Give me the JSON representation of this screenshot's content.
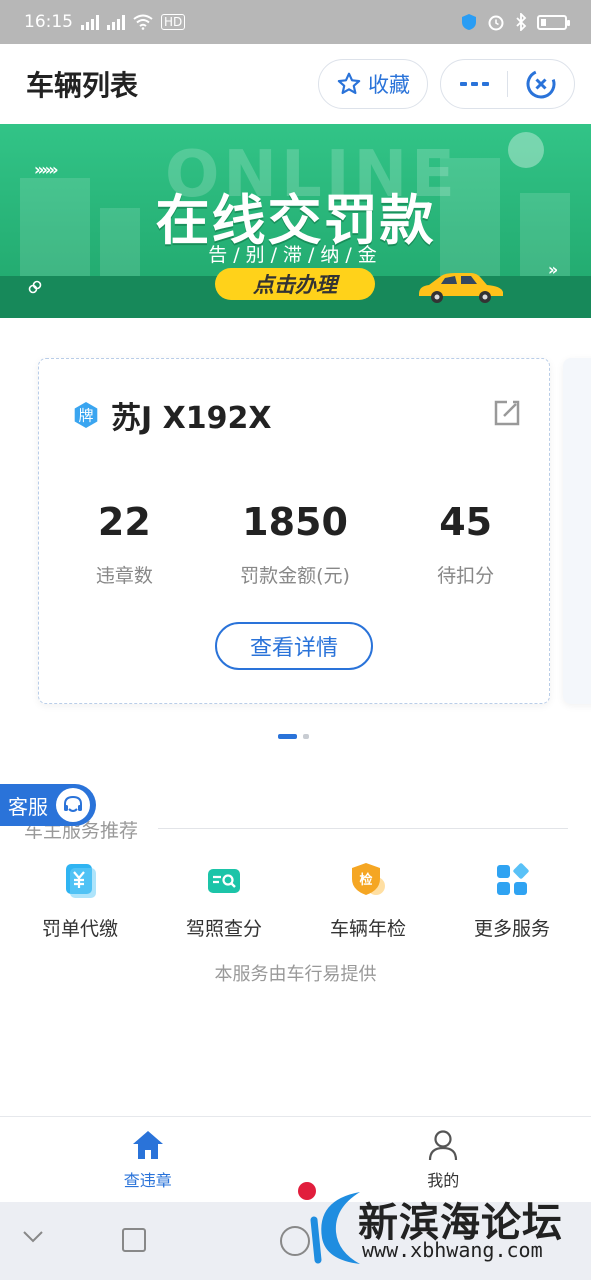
{
  "status_bar": {
    "time": "16:15",
    "net1": "4G",
    "net2": "4G",
    "hd": "HD"
  },
  "header": {
    "title": "车辆列表",
    "fav_label": "收藏"
  },
  "banner": {
    "bg_word": "ONLINE",
    "title": "在线交罚款",
    "subtitle": "告/别/滞/纳/金",
    "cta": "点击办理"
  },
  "vehicle": {
    "plate_badge": "牌",
    "plate": "苏J X192X",
    "stats": [
      {
        "value": "22",
        "label": "违章数"
      },
      {
        "value": "1850",
        "label": "罚款金额(元)"
      },
      {
        "value": "45",
        "label": "待扣分"
      }
    ],
    "detail_label": "查看详情"
  },
  "carousel": {
    "pages": 2,
    "current": 1
  },
  "kefu_label": "客服",
  "services": {
    "title": "车主服务推荐",
    "items": [
      {
        "label": "罚单代缴",
        "icon": "yen-card-icon",
        "color": "#2fb4f2"
      },
      {
        "label": "驾照查分",
        "icon": "license-search-icon",
        "color": "#1cc4a8"
      },
      {
        "label": "车辆年检",
        "icon": "inspection-shield-icon",
        "badge": "检",
        "color": "#f5a623"
      },
      {
        "label": "更多服务",
        "icon": "grid-icon",
        "color": "#2fa3f2"
      }
    ],
    "provider": "本服务由车行易提供"
  },
  "tabbar": {
    "tabs": [
      {
        "label": "查违章",
        "icon": "home-icon",
        "active": true
      },
      {
        "label": "我的",
        "icon": "user-icon",
        "active": false
      }
    ]
  },
  "watermark": {
    "name": "新滨海论坛",
    "url": "www.xbhwang.com"
  }
}
